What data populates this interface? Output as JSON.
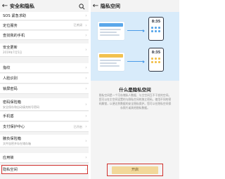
{
  "left": {
    "title": "安全和隐私",
    "back_icon": "arrow-left-icon",
    "search_icon": "search-icon",
    "items": [
      {
        "label": "SOS 紧急求助",
        "value": ""
      },
      {
        "label": "定位服务",
        "value": "已关闭"
      },
      {
        "label": "查找我的手机",
        "value": ""
      },
      {
        "label": "安全更新",
        "sub": "2019年7月5日",
        "value": ""
      },
      {
        "label": "指纹",
        "value": ""
      },
      {
        "label": "人脸识别",
        "value": ""
      },
      {
        "label": "锁屏密码",
        "value": ""
      },
      {
        "label": "密码保险箱",
        "sub": "安全保存和自动填充帐号密码",
        "value": ""
      },
      {
        "label": "手机盾",
        "value": ""
      },
      {
        "label": "支付保护中心",
        "value": "已开启"
      },
      {
        "label": "膀负保险箱",
        "sub": "文件加密并存在储存箱",
        "value": ""
      },
      {
        "label": "应用锁",
        "value": ""
      },
      {
        "label": "隐私空间",
        "value": ""
      }
    ]
  },
  "right": {
    "title": "隐私空间",
    "back_icon": "arrow-left-icon",
    "illustration": {
      "time_top": "8:35",
      "time_bottom": "8:35"
    },
    "headline": "什么是隐私空间",
    "description": "隐私空间是一个可存储私人数据、与主空间互不干扰的空间。您可以在主空间设置的与隐私空间的独立密码，使用不同的密码解锁，以便达到数据的安全隐私保护。您可以在隐私空间保存照片或其他隐私数据。",
    "button_label": "开启",
    "accent_color": "#d0312d",
    "button_color": "#f2d89a"
  }
}
